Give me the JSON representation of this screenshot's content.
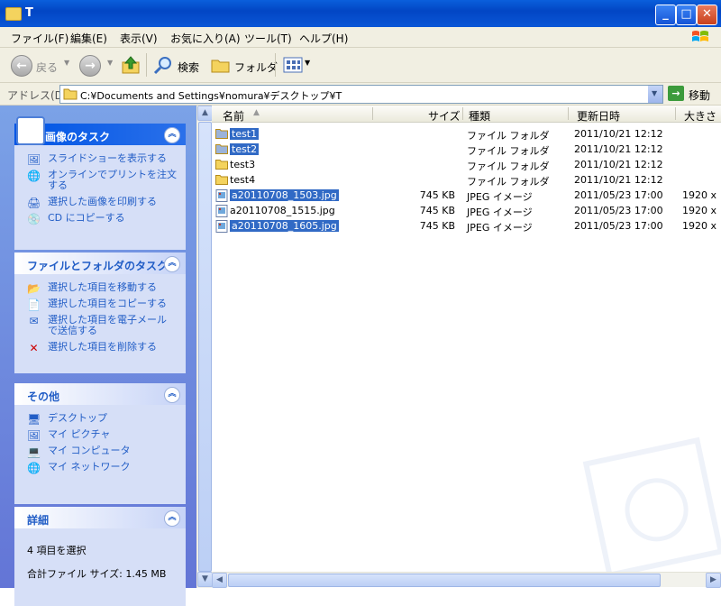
{
  "window": {
    "title": "T"
  },
  "menu": [
    "ファイル(F)",
    "編集(E)",
    "表示(V)",
    "お気に入り(A)",
    "ツール(T)",
    "ヘルプ(H)"
  ],
  "toolbar": {
    "back": "戻る",
    "search": "検索",
    "folders": "フォルダ"
  },
  "address": {
    "label": "アドレス(D)",
    "path": "C:¥Documents and Settings¥nomura¥デスクトップ¥T",
    "go": "移動"
  },
  "panels": {
    "image_tasks": {
      "title": "画像のタスク",
      "items": [
        "スライドショーを表示する",
        "オンラインでプリントを注文する",
        "選択した画像を印刷する",
        "CD にコピーする"
      ]
    },
    "file_tasks": {
      "title": "ファイルとフォルダのタスク",
      "items": [
        "選択した項目を移動する",
        "選択した項目をコピーする",
        "選択した項目を電子メールで送信する",
        "選択した項目を削除する"
      ]
    },
    "other": {
      "title": "その他",
      "items": [
        "デスクトップ",
        "マイ ピクチャ",
        "マイ コンピュータ",
        "マイ ネットワーク"
      ]
    },
    "details": {
      "title": "詳細",
      "selected": "4 項目を選択",
      "total": "合計ファイル サイズ: 1.45 MB"
    }
  },
  "columns": [
    "名前",
    "サイズ",
    "種類",
    "更新日時",
    "大きさ"
  ],
  "files": [
    {
      "name": "test1",
      "size": "",
      "type": "ファイル フォルダ",
      "date": "2011/10/21 12:12",
      "dim": "",
      "selected": true
    },
    {
      "name": "test2",
      "size": "",
      "type": "ファイル フォルダ",
      "date": "2011/10/21 12:12",
      "dim": "",
      "selected": true
    },
    {
      "name": "test3",
      "size": "",
      "type": "ファイル フォルダ",
      "date": "2011/10/21 12:12",
      "dim": "",
      "selected": false
    },
    {
      "name": "test4",
      "size": "",
      "type": "ファイル フォルダ",
      "date": "2011/10/21 12:12",
      "dim": "",
      "selected": false
    },
    {
      "name": "a20110708_1503.jpg",
      "size": "745 KB",
      "type": "JPEG イメージ",
      "date": "2011/05/23 17:00",
      "dim": "1920 x",
      "selected": true
    },
    {
      "name": "a20110708_1515.jpg",
      "size": "745 KB",
      "type": "JPEG イメージ",
      "date": "2011/05/23 17:00",
      "dim": "1920 x",
      "selected": false
    },
    {
      "name": "a20110708_1605.jpg",
      "size": "745 KB",
      "type": "JPEG イメージ",
      "date": "2011/05/23 17:00",
      "dim": "1920 x",
      "selected": true
    }
  ]
}
